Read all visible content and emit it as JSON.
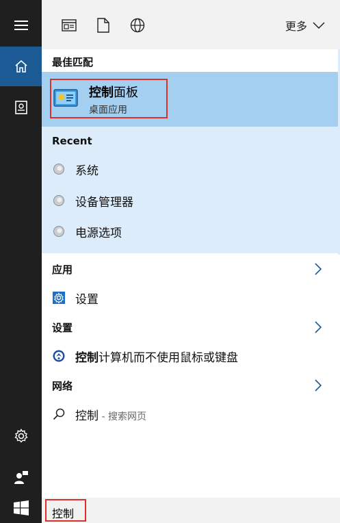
{
  "topbar": {
    "more_label": "更多"
  },
  "best_match": {
    "header": "最佳匹配",
    "title_bold": "控制",
    "title_rest": "面板",
    "subtitle": "桌面应用"
  },
  "recent": {
    "header": "Recent",
    "items": [
      {
        "label": "系统"
      },
      {
        "label": "设备管理器"
      },
      {
        "label": "电源选项"
      }
    ]
  },
  "apps": {
    "header": "应用",
    "item_label": "设置"
  },
  "settings": {
    "header": "设置",
    "item_bold": "控制",
    "item_rest": "计算机而不使用鼠标或键盘"
  },
  "web": {
    "header": "网络",
    "item_bold": "控制",
    "item_suffix": " - 搜索网页"
  },
  "search": {
    "value": "控制"
  },
  "colors": {
    "accent": "#1b5a95",
    "highlight": "#a4cff0",
    "recent_bg": "#dcecfa",
    "annotation_red": "#d9302c"
  }
}
